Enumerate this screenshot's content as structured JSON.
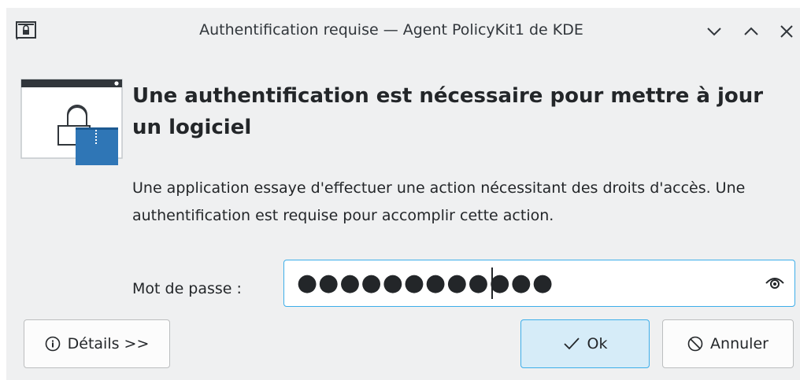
{
  "window": {
    "title": "Authentification requise — Agent PolicyKit1 de KDE",
    "controls": [
      "minimize",
      "maximize",
      "close"
    ]
  },
  "header": {
    "heading": "Une authentification est nécessaire pour mettre à jour un logiciel",
    "description": "Une application essaye d'effectuer une action nécessitant des droits d'accès. Une authentification est requise pour accomplir cette action."
  },
  "password": {
    "label": "Mot de passe :",
    "value": "●●●●●●●●●●●●",
    "reveal_icon": "eye-icon"
  },
  "buttons": {
    "details": "Détails >>",
    "ok": "Ok",
    "cancel": "Annuler"
  },
  "colors": {
    "accent": "#3daee9",
    "window_bg": "#eff0f1",
    "ok_bg": "#d6ecf8",
    "badge_blue": "#2f76b6"
  }
}
